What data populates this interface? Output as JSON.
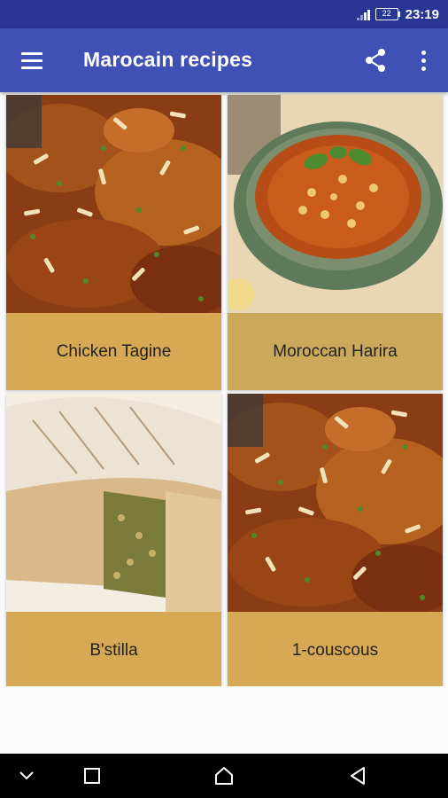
{
  "status_bar": {
    "battery": "22",
    "time": "23:19"
  },
  "app_bar": {
    "title": "Marocain recipes",
    "color": "#3f51b5"
  },
  "recipes": [
    {
      "name": "Chicken Tagine"
    },
    {
      "name": "Moroccan Harira"
    },
    {
      "name": "B'stilla"
    },
    {
      "name": "1-couscous"
    }
  ],
  "nav_bar": {
    "icons": [
      "chevron-down-icon",
      "recents-square-icon",
      "home-icon",
      "back-triangle-icon"
    ]
  }
}
